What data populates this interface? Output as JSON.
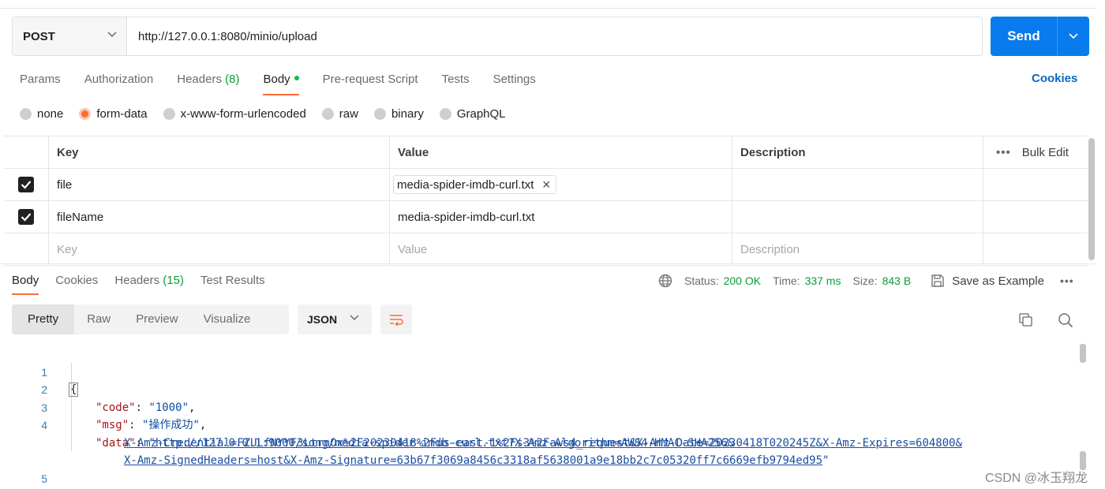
{
  "request": {
    "method": "POST",
    "url": "http://127.0.0.1:8080/minio/upload",
    "send_label": "Send"
  },
  "request_tabs": [
    {
      "label": "Params"
    },
    {
      "label": "Authorization"
    },
    {
      "label": "Headers",
      "count": "(8)"
    },
    {
      "label": "Body",
      "active": true
    },
    {
      "label": "Pre-request Script"
    },
    {
      "label": "Tests"
    },
    {
      "label": "Settings"
    }
  ],
  "cookies_label": "Cookies",
  "body_types": [
    "none",
    "form-data",
    "x-www-form-urlencoded",
    "raw",
    "binary",
    "GraphQL"
  ],
  "body_type_selected": "form-data",
  "form_table": {
    "headers": {
      "key": "Key",
      "value": "Value",
      "description": "Description",
      "bulk_edit": "Bulk Edit"
    },
    "rows": [
      {
        "checked": true,
        "key": "file",
        "value": "media-spider-imdb-curl.txt",
        "value_type": "file"
      },
      {
        "checked": true,
        "key": "fileName",
        "value": "media-spider-imdb-curl.txt",
        "value_type": "text"
      }
    ],
    "placeholders": {
      "key": "Key",
      "value": "Value",
      "description": "Description"
    }
  },
  "response_tabs": [
    {
      "label": "Body",
      "active": true
    },
    {
      "label": "Cookies"
    },
    {
      "label": "Headers",
      "count": "(15)"
    },
    {
      "label": "Test Results"
    }
  ],
  "response_meta": {
    "status_label": "Status:",
    "status_value": "200 OK",
    "time_label": "Time:",
    "time_value": "337 ms",
    "size_label": "Size:",
    "size_value": "843 B",
    "save_example": "Save as Example"
  },
  "view_modes": [
    "Pretty",
    "Raw",
    "Preview",
    "Visualize"
  ],
  "view_mode_selected": "Pretty",
  "format": "JSON",
  "code": {
    "line_numbers": [
      "1",
      "2",
      "3",
      "4",
      "5"
    ],
    "open_brace": "{",
    "close_brace": "}",
    "code_key": "\"code\"",
    "code_value": "\"1000\"",
    "msg_key": "\"msg\"",
    "msg_value": "\"操作成功\"",
    "data_key": "\"data\"",
    "data_line1": "http://127.0.0.1:9000/song/media-spider-imdb-curl.txt?X-Amz-Algorithm=AWS4-HMAC-SHA256&",
    "data_line2": "X-Amz-Credential=FZULfNYYF3LtrnOx%2F20230418%2Fus-east-1%2Fs3%2Faws4_request&X-Amz-Date=20230418T020245Z&X-Amz-Expires=604800&",
    "data_line3": "X-Amz-SignedHeaders=host&X-Amz-Signature=63b67f3069a8456c3318af5638001a9e18bb2c7c05320ff7c6669efb9794ed95"
  },
  "watermark": "CSDN @冰玉翔龙",
  "colors": {
    "accent": "#ff6c37",
    "send": "#097bed",
    "success": "#0d9b3a",
    "link": "#0b66c3"
  }
}
